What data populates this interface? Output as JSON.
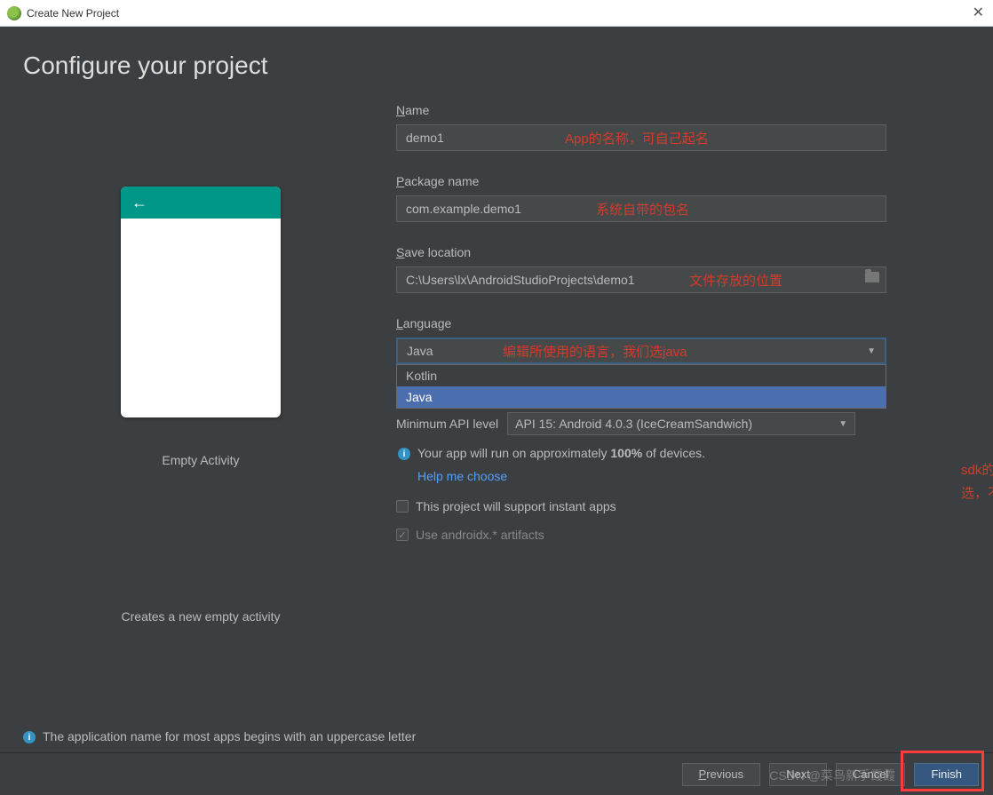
{
  "titlebar": {
    "title": "Create New Project"
  },
  "header": {
    "title": "Configure your project"
  },
  "preview": {
    "activity_name": "Empty Activity",
    "activity_desc": "Creates a new empty activity"
  },
  "form": {
    "name_label": "Name",
    "name_value": "demo1",
    "package_label": "Package name",
    "package_value": "com.example.demo1",
    "save_label": "Save location",
    "save_value": "C:\\Users\\lx\\AndroidStudioProjects\\demo1",
    "language_label": "Language",
    "language_value": "Java",
    "language_options": [
      "Kotlin",
      "Java"
    ],
    "min_api_label": "Minimum API level",
    "min_api_value": "API 15: Android 4.0.3 (IceCreamSandwich)",
    "info_text_pre": "Your app will run on approximately ",
    "info_text_pct": "100%",
    "info_text_post": " of devices.",
    "help_link": "Help me choose",
    "cb_instant": "This project will support instant apps",
    "cb_androidx": "Use androidx.* artifacts"
  },
  "annotations": {
    "name": "App的名称，可自己起名",
    "package": "系统自带的包名",
    "save": "文件存放的位置",
    "language": "编辑所使用的语言，我们选java",
    "sdk_line1": "sdk的最低配置，自己",
    "sdk_line2": "选，不要选太高就行"
  },
  "footer": {
    "hint": "The application name for most apps begins with an uppercase letter"
  },
  "buttons": {
    "previous": "Previous",
    "next": "Next",
    "cancel": "Cancel",
    "finish": "Finish"
  },
  "watermark": "CSDN @菜鸟新手霞霞"
}
